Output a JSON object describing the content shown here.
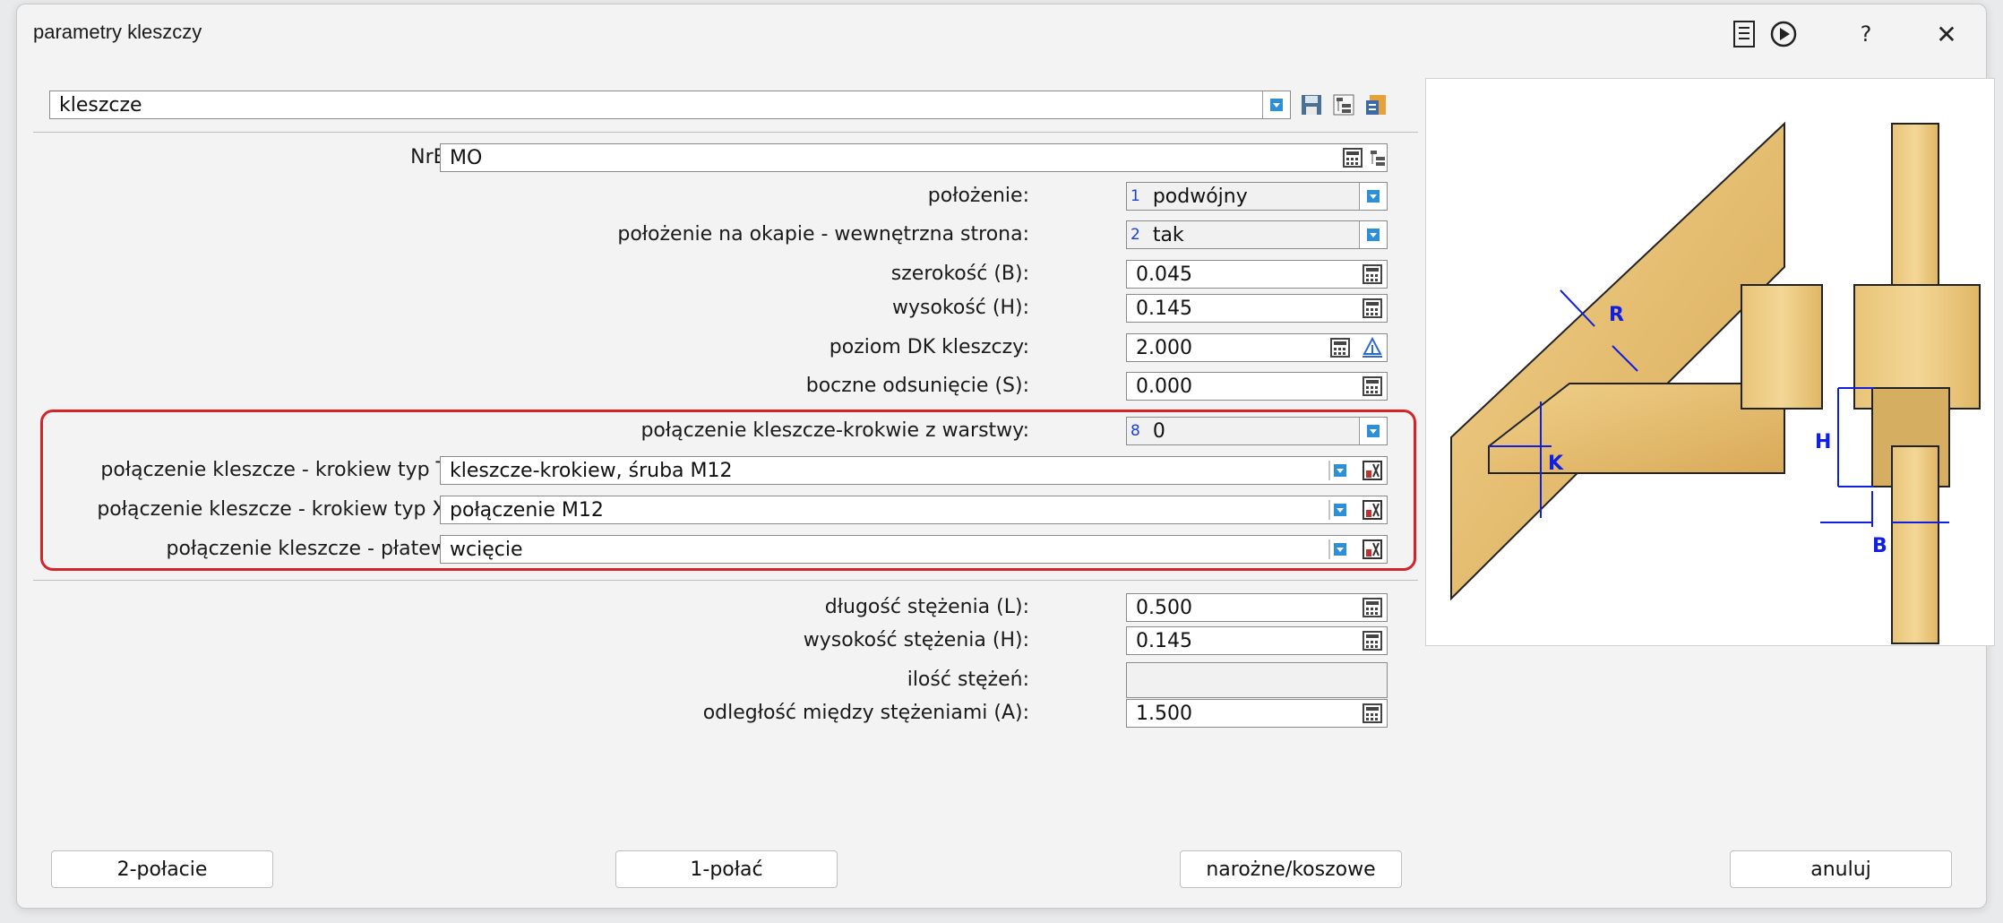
{
  "window": {
    "title": "parametry kleszczy"
  },
  "titlebar": {
    "help_label": "?",
    "close_label": "✕"
  },
  "top_select": {
    "value": "kleszcze"
  },
  "nre": {
    "label": "NrE:",
    "value": "MO"
  },
  "rows": {
    "polozenie": {
      "label": "położenie:",
      "num": "1",
      "value": "podwójny"
    },
    "okap": {
      "label": "położenie na okapie - wewnętrzna strona:",
      "num": "2",
      "value": "tak"
    },
    "szerokosc": {
      "label": "szerokość (B):",
      "value": "0.045"
    },
    "wysokosc": {
      "label": "wysokość (H):",
      "value": "0.145"
    },
    "poziom": {
      "label": "poziom DK kleszczy:",
      "value": "2.000"
    },
    "boczne": {
      "label": "boczne odsunięcie (S):",
      "value": "0.000"
    },
    "warstwy": {
      "label": "połączenie kleszcze-krokwie z warstwy:",
      "num": "8",
      "value": "0"
    },
    "typT": {
      "label": "połączenie kleszcze - krokiew typ T:",
      "value": "kleszcze-krokiew, śruba M12"
    },
    "typX": {
      "label": "połączenie kleszcze - krokiew typ X:",
      "value": "połączenie M12"
    },
    "platew": {
      "label": "połączenie kleszcze - płatew:",
      "value": "wcięcie"
    },
    "dlugosc": {
      "label": "długość stężenia (L):",
      "value": "0.500"
    },
    "wys_stez": {
      "label": "wysokość stężenia (H):",
      "value": "0.145"
    },
    "ilosc": {
      "label": "ilość stężeń:",
      "value": ""
    },
    "odleglosc": {
      "label": "odległość między stężeniami (A):",
      "value": "1.500"
    }
  },
  "diagram": {
    "labels": {
      "R": "R",
      "K": "K",
      "H": "H",
      "B": "B"
    },
    "line_color": "#1020e0"
  },
  "buttons": {
    "b2": "2-połacie",
    "b1": "1-połać",
    "naroz": "narożne/koszowe",
    "anuluj": "anuluj"
  }
}
